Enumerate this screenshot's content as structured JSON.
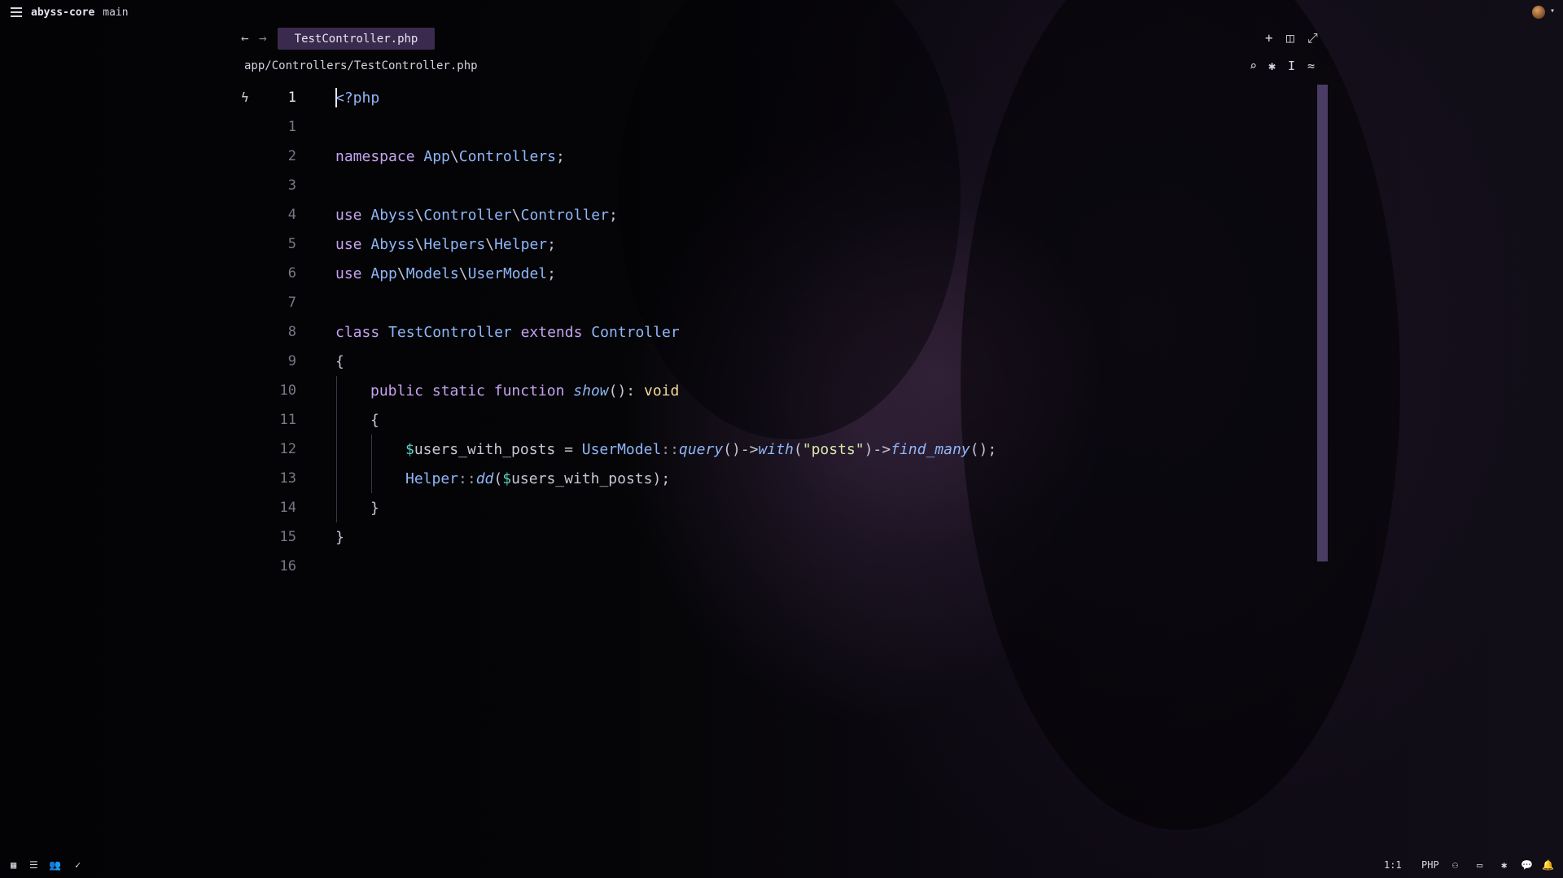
{
  "titlebar": {
    "project": "abyss-core",
    "branch": "main"
  },
  "tab": {
    "active_label": "TestController.php"
  },
  "breadcrumb": "app/Controllers/TestController.php",
  "editor": {
    "lines": [
      {
        "num": "1"
      },
      {
        "num": "1"
      },
      {
        "num": "2"
      },
      {
        "num": "3"
      },
      {
        "num": "4"
      },
      {
        "num": "5"
      },
      {
        "num": "6"
      },
      {
        "num": "7"
      },
      {
        "num": "8"
      },
      {
        "num": "9"
      },
      {
        "num": "10"
      },
      {
        "num": "11"
      },
      {
        "num": "12"
      },
      {
        "num": "13"
      },
      {
        "num": "14"
      },
      {
        "num": "15"
      },
      {
        "num": "16"
      }
    ],
    "code": {
      "l0": [
        "<?php"
      ],
      "l2": [
        "namespace",
        " App",
        "\\",
        "Controllers",
        ";"
      ],
      "l4": [
        "use",
        " Abyss",
        "\\",
        "Controller",
        "\\",
        "Controller",
        ";"
      ],
      "l5": [
        "use",
        " Abyss",
        "\\",
        "Helpers",
        "\\",
        "Helper",
        ";"
      ],
      "l6": [
        "use",
        " App",
        "\\",
        "Models",
        "\\",
        "UserModel",
        ";"
      ],
      "l8": [
        "class",
        " TestController",
        " extends",
        " Controller"
      ],
      "l9": [
        "{"
      ],
      "l10": [
        "public",
        " static",
        " function",
        " show",
        "():",
        " void"
      ],
      "l11": [
        "{"
      ],
      "l12": [
        "$",
        "users_with_posts",
        " = ",
        "UserModel",
        "::",
        "query",
        "()->",
        "with",
        "(",
        "\"posts\"",
        ")->",
        "find_many",
        "();"
      ],
      "l13": [
        "Helper",
        "::",
        "dd",
        "(",
        "$",
        "users_with_posts",
        ");"
      ],
      "l14": [
        "}"
      ],
      "l15": [
        "}"
      ]
    }
  },
  "statusbar": {
    "cursor_pos": "1:1",
    "language": "PHP"
  },
  "colors": {
    "tab_bg": "#3a2b4e",
    "keyword": "#c6a2f0",
    "namespace": "#8fb6f7",
    "string": "#d7e6a8",
    "variable": "#5fd0c8",
    "type": "#f3d99a",
    "scrollbar": "#5a4a78"
  },
  "icons": {
    "menu": "hamburger-icon",
    "back": "arrow-left-icon",
    "forward": "arrow-right-icon",
    "new": "plus-icon",
    "split": "split-pane-icon",
    "maximize": "maximize-icon",
    "search": "search-icon",
    "assist": "sparkle-icon",
    "cursor": "text-cursor-icon",
    "settings": "sliders-icon",
    "gutter": "bolt-icon"
  }
}
